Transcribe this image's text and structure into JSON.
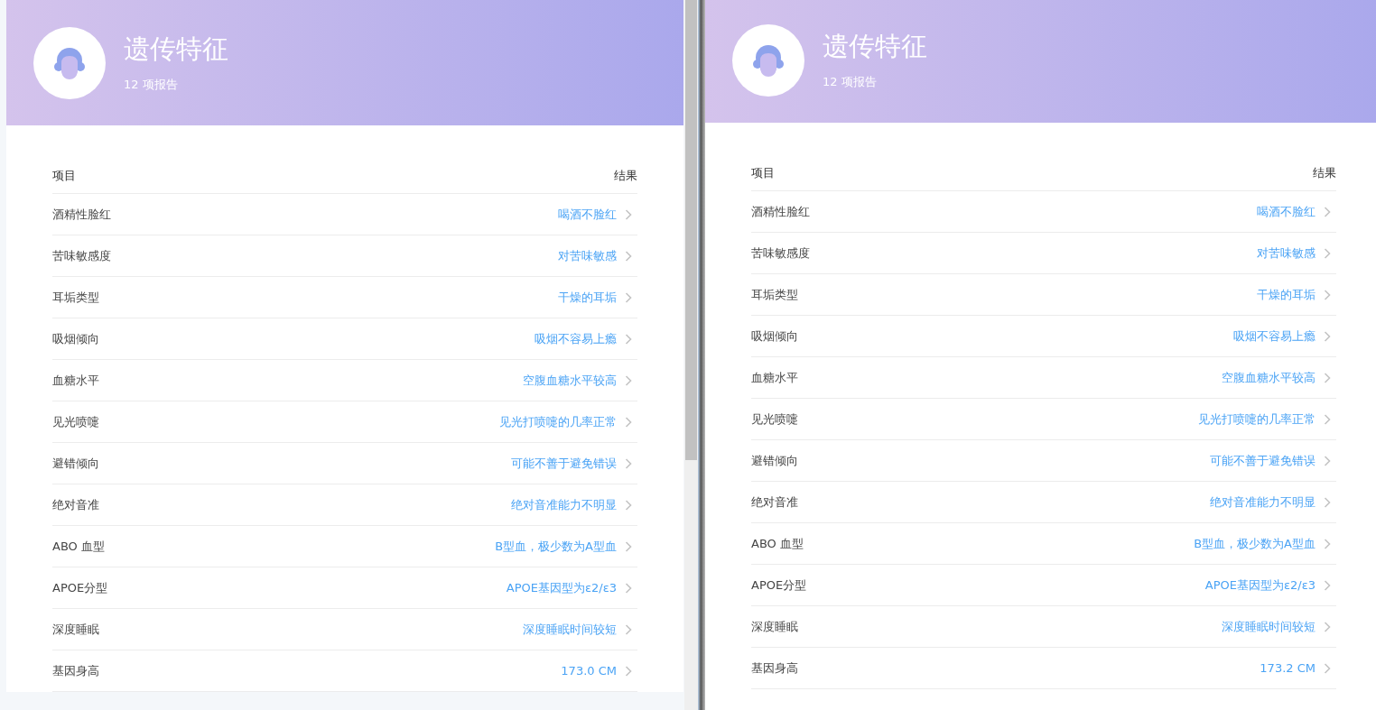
{
  "panes": [
    {
      "title": "遗传特征",
      "subtitle": "12 项报告",
      "columns": [
        "项目",
        "结果"
      ],
      "rows": [
        {
          "item": "酒精性脸红",
          "result": "喝酒不脸红"
        },
        {
          "item": "苦味敏感度",
          "result": "对苦味敏感"
        },
        {
          "item": "耳垢类型",
          "result": "干燥的耳垢"
        },
        {
          "item": "吸烟倾向",
          "result": "吸烟不容易上瘾"
        },
        {
          "item": "血糖水平",
          "result": "空腹血糖水平较高"
        },
        {
          "item": "见光喷嚏",
          "result": "见光打喷嚏的几率正常"
        },
        {
          "item": "避错倾向",
          "result": "可能不善于避免错误"
        },
        {
          "item": "绝对音准",
          "result": "绝对音准能力不明显"
        },
        {
          "item": "ABO 血型",
          "result": "B型血，极少数为A型血"
        },
        {
          "item": "APOE分型",
          "result": "APOE基因型为ε2/ε3"
        },
        {
          "item": "深度睡眠",
          "result": "深度睡眠时间较短"
        },
        {
          "item": "基因身高",
          "result": "173.0 CM"
        }
      ]
    },
    {
      "title": "遗传特征",
      "subtitle": "12 项报告",
      "columns": [
        "项目",
        "结果"
      ],
      "rows": [
        {
          "item": "酒精性脸红",
          "result": "喝酒不脸红"
        },
        {
          "item": "苦味敏感度",
          "result": "对苦味敏感"
        },
        {
          "item": "耳垢类型",
          "result": "干燥的耳垢"
        },
        {
          "item": "吸烟倾向",
          "result": "吸烟不容易上瘾"
        },
        {
          "item": "血糖水平",
          "result": "空腹血糖水平较高"
        },
        {
          "item": "见光喷嚏",
          "result": "见光打喷嚏的几率正常"
        },
        {
          "item": "避错倾向",
          "result": "可能不善于避免错误"
        },
        {
          "item": "绝对音准",
          "result": "绝对音准能力不明显"
        },
        {
          "item": "ABO 血型",
          "result": "B型血，极少数为A型血"
        },
        {
          "item": "APOE分型",
          "result": "APOE基因型为ε2/ε3"
        },
        {
          "item": "深度睡眠",
          "result": "深度睡眠时间较短"
        },
        {
          "item": "基因身高",
          "result": "173.2 CM"
        }
      ]
    }
  ]
}
